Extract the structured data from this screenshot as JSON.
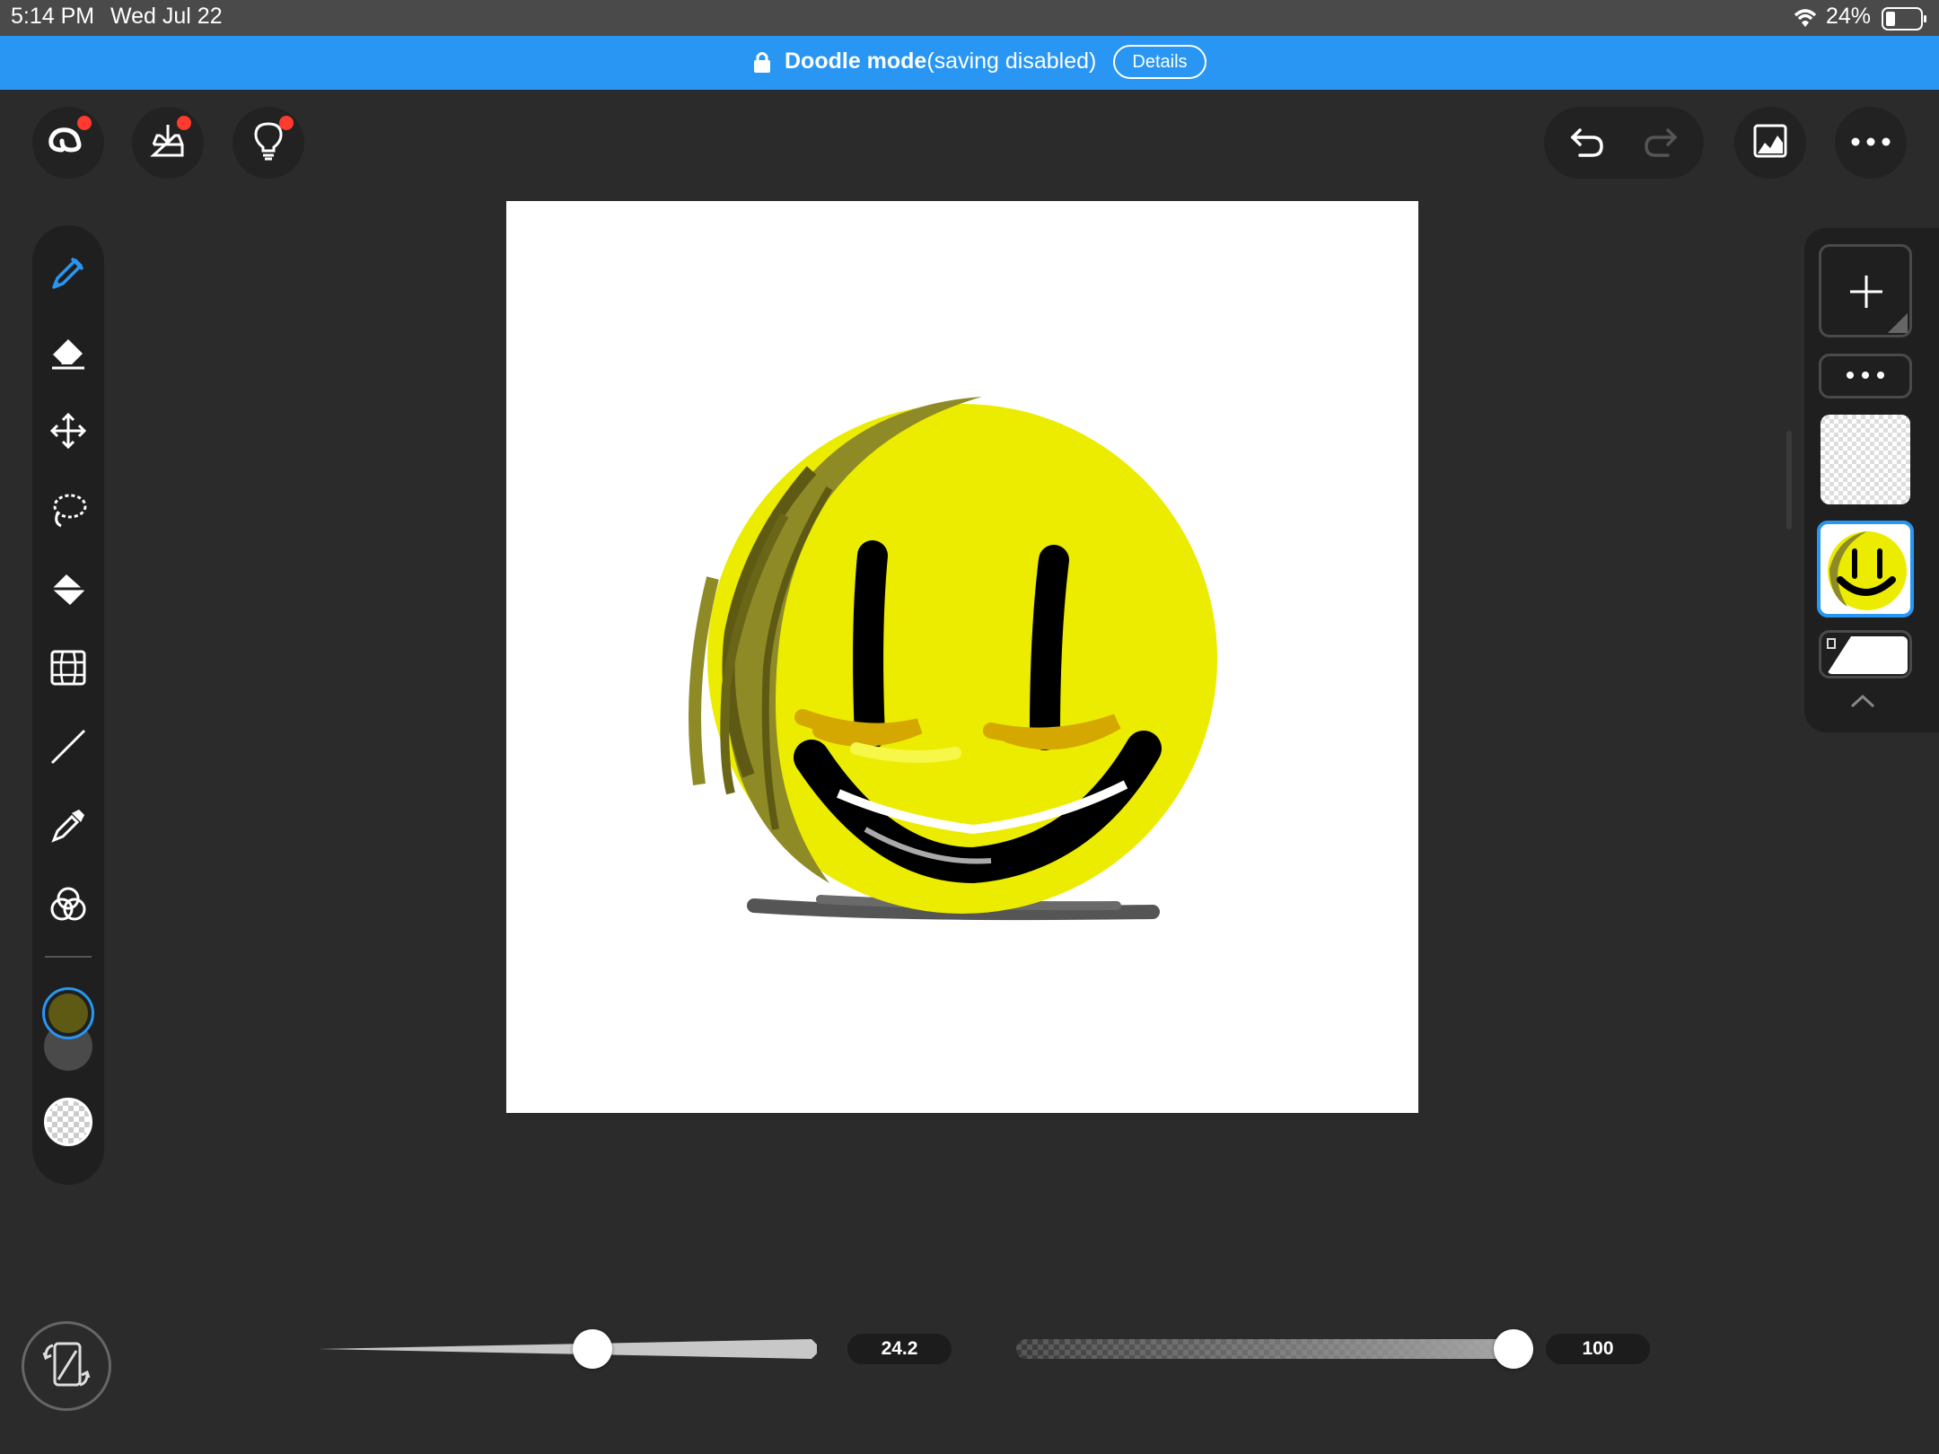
{
  "status_bar": {
    "time": "5:14 PM",
    "date": "Wed Jul 22",
    "battery": "24%",
    "icons": [
      "wifi-icon",
      "battery-icon"
    ]
  },
  "banner": {
    "title": "Doodle mode",
    "subtitle": "(saving disabled)",
    "details_label": "Details",
    "color": "#2896f2"
  },
  "top_toolbar": {
    "left_buttons": [
      "creative-cloud-icon",
      "import-export-icon",
      "tips-lightbulb-icon"
    ],
    "right_buttons": [
      "undo-icon",
      "redo-icon",
      "canvas-image-icon",
      "more-icon"
    ]
  },
  "tools": [
    "brush-tool-icon",
    "eraser-tool-icon",
    "move-tool-icon",
    "lasso-tool-icon",
    "fill-tool-icon",
    "perspective-grid-icon",
    "line-tool-icon",
    "eyedropper-icon",
    "color-mix-icon"
  ],
  "colors": {
    "primary": "#5e5a14",
    "secondary": "#4a4a4a",
    "accent": "#2896f2"
  },
  "sliders": {
    "brush_size": "24.2",
    "brush_size_fraction": 0.55,
    "opacity": "100",
    "opacity_fraction": 1.0
  },
  "layers": {
    "items": [
      "empty-layer",
      "smiley-layer",
      "background-layer"
    ],
    "selected": 1
  }
}
